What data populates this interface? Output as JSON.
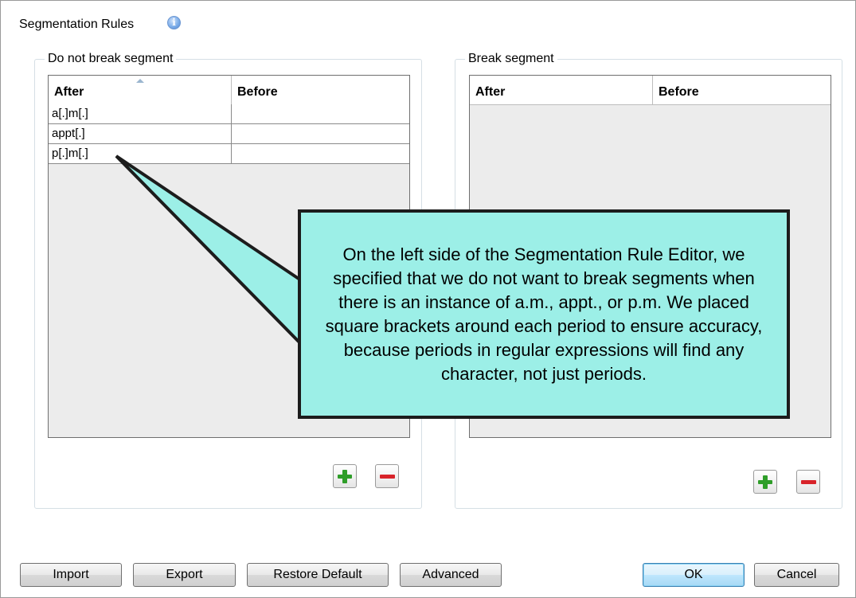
{
  "panel": {
    "title": "Segmentation Rules",
    "info_icon": "info-icon"
  },
  "do_not_break": {
    "label": "Do not break segment",
    "columns": [
      "After",
      "Before"
    ],
    "rows": [
      {
        "after": "a[.]m[.]",
        "before": ""
      },
      {
        "after": "appt[.]",
        "before": ""
      },
      {
        "after": "p[.]m[.]",
        "before": ""
      }
    ]
  },
  "break": {
    "label": "Break segment",
    "columns": [
      "After",
      "Before"
    ],
    "rows": []
  },
  "callout": {
    "text": "On the left side of the Segmentation Rule Editor, we specified that we do not want to break segments when there is an instance of a.m., appt., or p.m. We placed square brackets around each period to ensure accuracy, because periods in regular expressions will find any character, not just periods.",
    "color": "#9cefe7"
  },
  "buttons": {
    "import": "Import",
    "export": "Export",
    "restore_default": "Restore Default",
    "advanced": "Advanced",
    "ok": "OK",
    "cancel": "Cancel"
  },
  "colors": {
    "add": "#2f9e29",
    "remove": "#d8232a",
    "accent": "#3c7fb1"
  }
}
